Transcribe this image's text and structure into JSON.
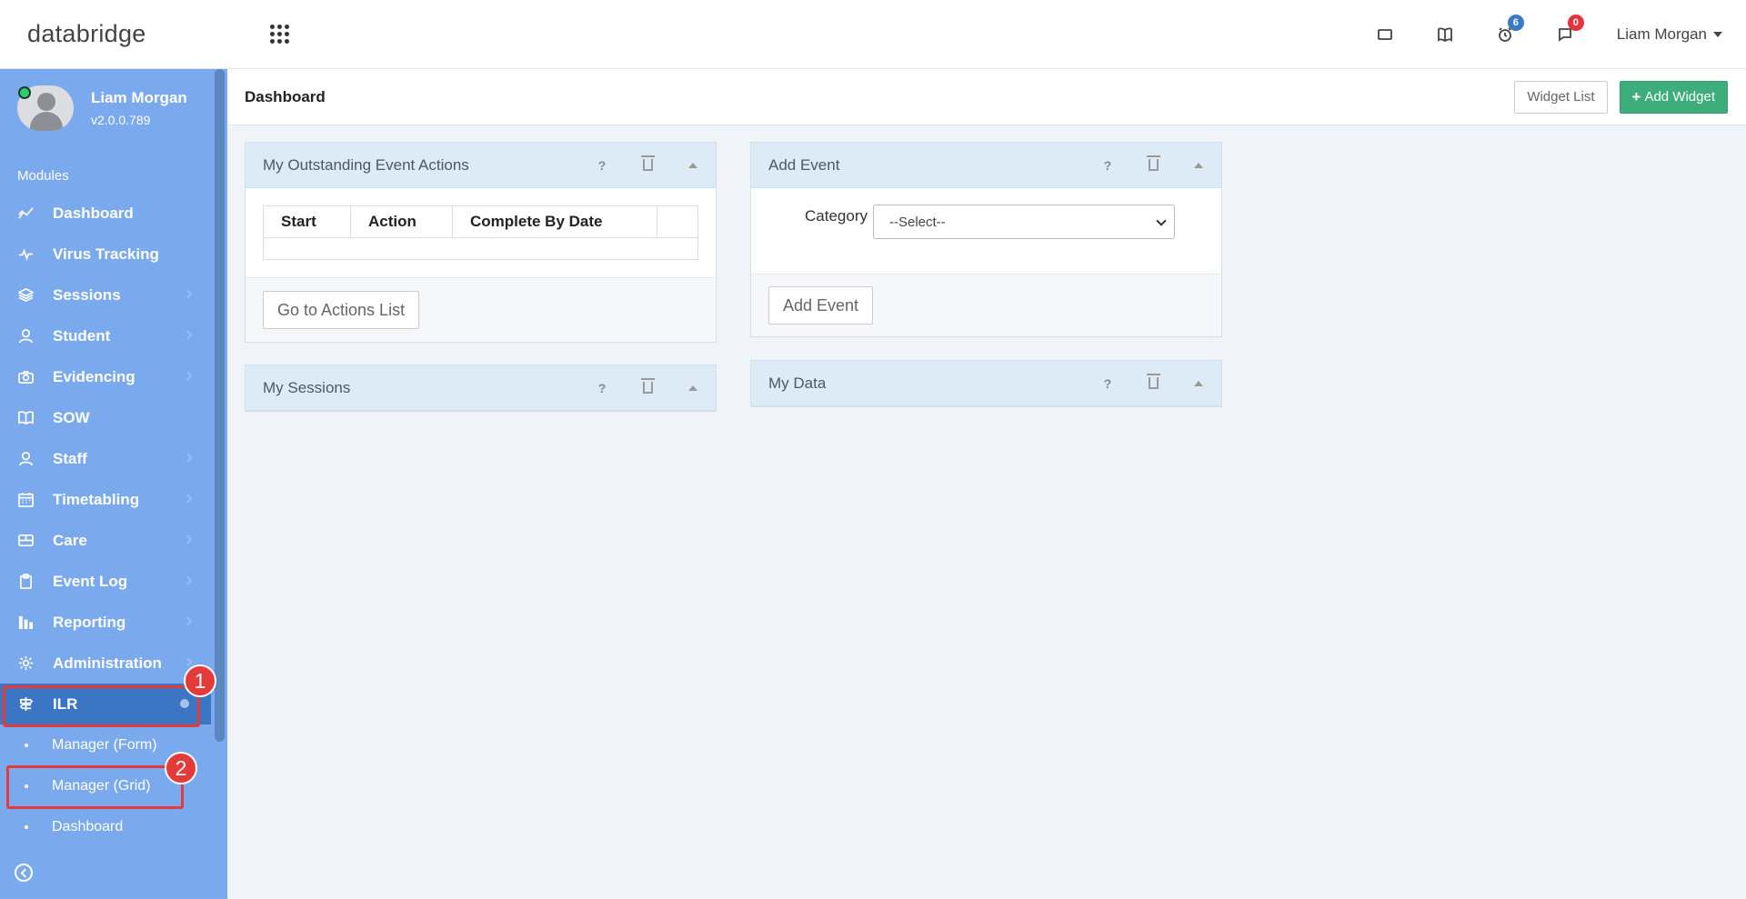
{
  "brand": {
    "name": "databridge"
  },
  "topbar": {
    "icons": [
      {
        "name": "window-icon"
      },
      {
        "name": "book-icon"
      },
      {
        "name": "clock-icon",
        "badge": "6"
      },
      {
        "name": "chat-icon",
        "badge": "0"
      }
    ],
    "user_name": "Liam Morgan"
  },
  "sidebar": {
    "profile_name": "Liam Morgan",
    "version": "v2.0.0.789",
    "modules_label": "Modules",
    "items": [
      {
        "label": "Dashboard",
        "icon": "chart-line-icon"
      },
      {
        "label": "Virus Tracking",
        "icon": "pulse-icon"
      },
      {
        "label": "Sessions",
        "icon": "layers-icon"
      },
      {
        "label": "Student",
        "icon": "user-icon"
      },
      {
        "label": "Evidencing",
        "icon": "camera-icon"
      },
      {
        "label": "SOW",
        "icon": "book-open-icon"
      },
      {
        "label": "Staff",
        "icon": "user-icon"
      },
      {
        "label": "Timetabling",
        "icon": "calendar-icon"
      },
      {
        "label": "Care",
        "icon": "monitor-icon"
      },
      {
        "label": "Event Log",
        "icon": "clipboard-icon"
      },
      {
        "label": "Reporting",
        "icon": "report-icon"
      },
      {
        "label": "Administration",
        "icon": "gear-icon"
      },
      {
        "label": "ILR",
        "icon": "signpost-icon"
      }
    ],
    "sub_items": [
      "Manager (Form)",
      "Manager (Grid)",
      "Dashboard"
    ]
  },
  "callouts": [
    "1",
    "2"
  ],
  "page": {
    "title": "Dashboard",
    "widget_list_label": "Widget List",
    "add_widget_label": "Add Widget"
  },
  "widgets": {
    "outstanding": {
      "title": "My Outstanding Event Actions",
      "columns": [
        "Start",
        "Action",
        "Complete By Date",
        ""
      ],
      "button": "Go to Actions List"
    },
    "sessions": {
      "title": "My Sessions"
    },
    "add_event": {
      "title": "Add Event",
      "category_label": "Category",
      "select_value": "--Select--",
      "button": "Add Event"
    },
    "my_data": {
      "title": "My Data"
    },
    "help_symbol": "?"
  }
}
